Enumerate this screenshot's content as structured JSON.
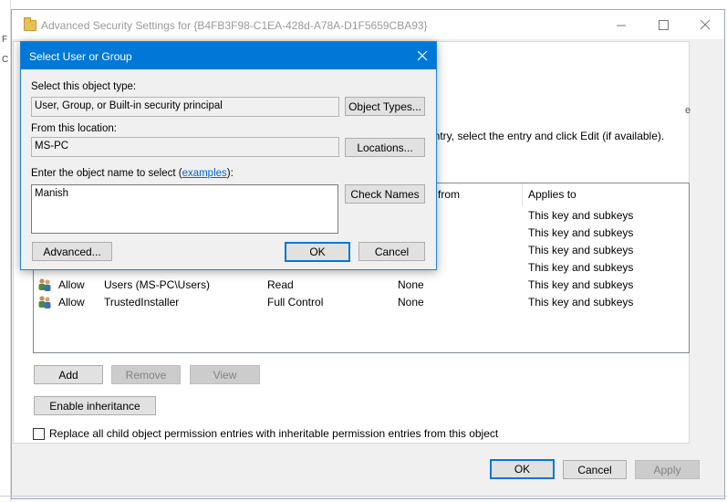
{
  "background_window": {
    "title": "Advanced Security Settings for {B4FB3F98-C1EA-428d-A78A-D1F5659CBA93}",
    "instruction_text": "entry, select the entry and click Edit (if available).",
    "columns": {
      "inherited_from": "d from",
      "applies_to": "Applies to"
    },
    "applies_rows_partial": [
      "This key and subkeys",
      "This key and subkeys",
      "This key and subkeys",
      "This key and subkeys"
    ],
    "permission_rows": [
      {
        "type": "Allow",
        "principal": "Users (MS-PC\\Users)",
        "access": "Read",
        "inherited_from": "None",
        "applies_to": "This key and subkeys"
      },
      {
        "type": "Allow",
        "principal": "TrustedInstaller",
        "access": "Full Control",
        "inherited_from": "None",
        "applies_to": "This key and subkeys"
      }
    ],
    "buttons": {
      "add": "Add",
      "remove": "Remove",
      "view": "View",
      "enable_inheritance": "Enable inheritance",
      "ok": "OK",
      "cancel": "Cancel",
      "apply": "Apply"
    },
    "replace_checkbox_label": "Replace all child object permission entries with inheritable permission entries from this object"
  },
  "dialog": {
    "title": "Select User or Group",
    "object_type_label": "Select this object type:",
    "object_type_value": "User, Group, or Built-in security principal",
    "object_types_button": "Object Types...",
    "location_label": "From this location:",
    "location_value": "MS-PC",
    "locations_button": "Locations...",
    "object_name_label_prefix": "Enter the object name to select (",
    "examples_link": "examples",
    "object_name_label_suffix": "):",
    "object_name_value": "Manish",
    "check_names_button": "Check Names",
    "advanced_button": "Advanced...",
    "ok_button": "OK",
    "cancel_button": "Cancel"
  }
}
